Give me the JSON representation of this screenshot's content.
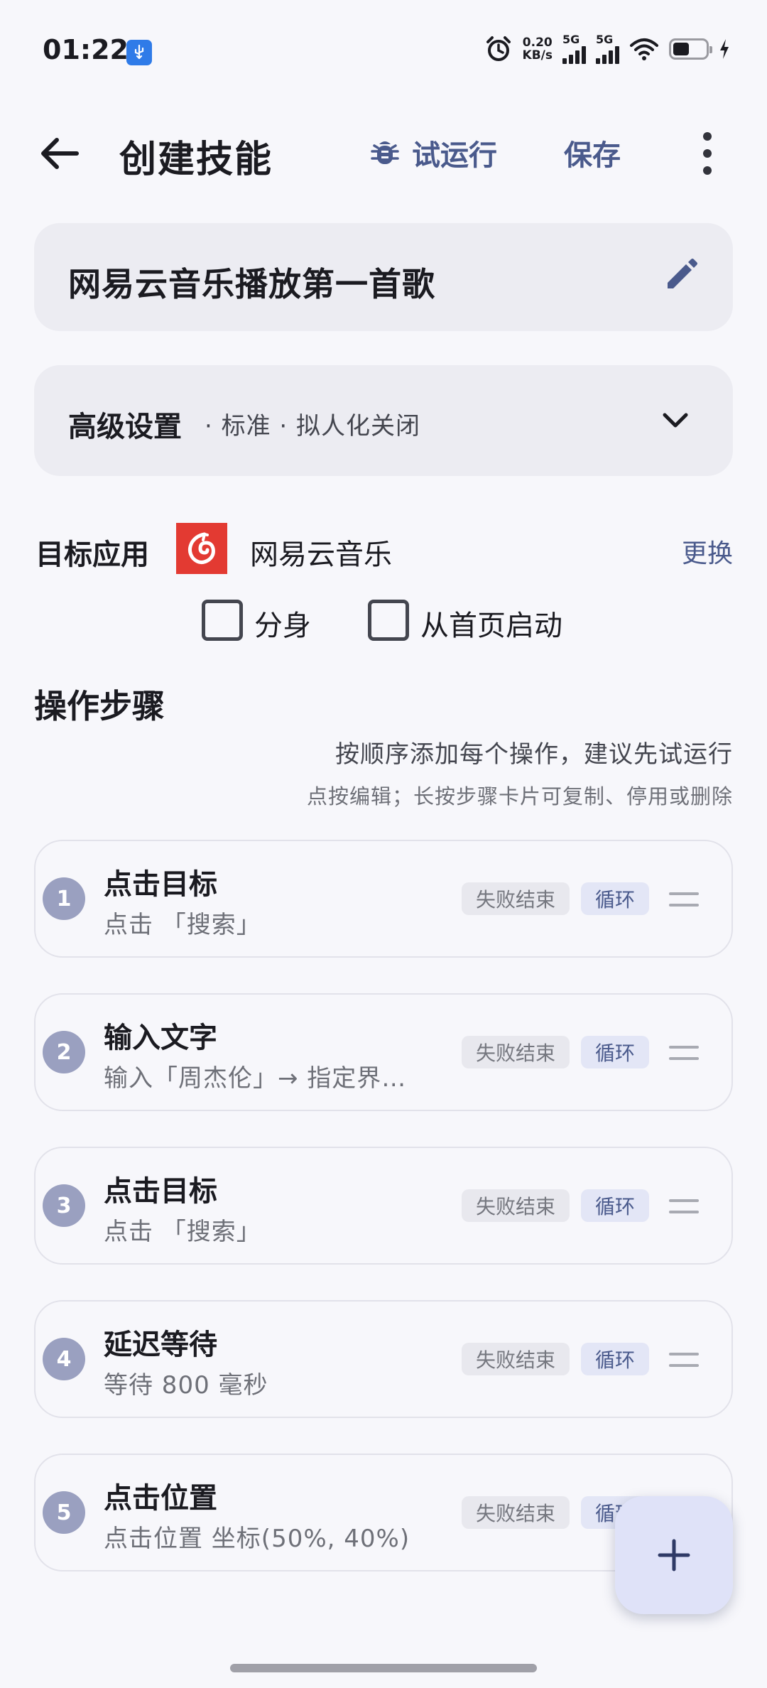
{
  "status_bar": {
    "time": "01:22",
    "net_speed_value": "0.20",
    "net_speed_unit": "KB/s",
    "signal1_label": "5G",
    "signal2_label": "5G",
    "icons": [
      "usb-icon",
      "alarm-icon",
      "signal-icon",
      "wifi-icon",
      "battery-icon",
      "charging-icon"
    ]
  },
  "header": {
    "title": "创建技能",
    "trial_run": "试运行",
    "save": "保存"
  },
  "skill": {
    "name": "网易云音乐播放第一首歌"
  },
  "advanced": {
    "title": "高级设置",
    "summary": "· 标准 · 拟人化关闭"
  },
  "target": {
    "label": "目标应用",
    "app_name": "网易云音乐",
    "change": "更换",
    "app_color": "#e33a32",
    "options": [
      {
        "label": "分身",
        "checked": false
      },
      {
        "label": "从首页启动",
        "checked": false
      }
    ]
  },
  "steps_section": {
    "title": "操作步骤",
    "hint": "按顺序添加每个操作，建议先试运行",
    "subhint": "点按编辑；长按步骤卡片可复制、停用或删除"
  },
  "steps": [
    {
      "num": "1",
      "title": "点击目标",
      "desc": "点击 「搜索」",
      "fail": "失败结束",
      "loop": "循环"
    },
    {
      "num": "2",
      "title": "输入文字",
      "desc": "输入「周杰伦」→ 指定界…",
      "fail": "失败结束",
      "loop": "循环"
    },
    {
      "num": "3",
      "title": "点击目标",
      "desc": "点击 「搜索」",
      "fail": "失败结束",
      "loop": "循环"
    },
    {
      "num": "4",
      "title": "延迟等待",
      "desc": "等待 800 毫秒",
      "fail": "失败结束",
      "loop": "循环"
    },
    {
      "num": "5",
      "title": "点击位置",
      "desc": "点击位置 坐标(50%, 40%)",
      "fail": "失败结束",
      "loop": "循环"
    }
  ],
  "colors": {
    "accent": "#4a5a8c",
    "background": "#f7f7fb",
    "card": "#ececf2",
    "fab": "#dfe2f8"
  }
}
